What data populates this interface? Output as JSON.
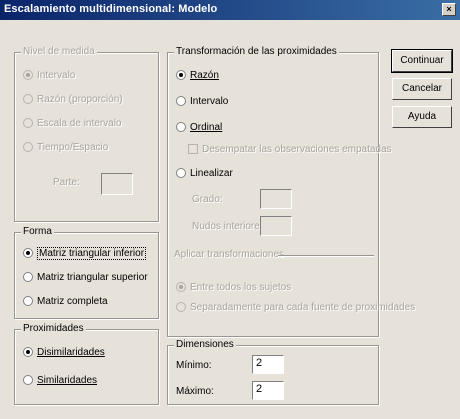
{
  "window": {
    "title": "Escalamiento multidimensional: Modelo",
    "close": "×"
  },
  "nivel_medida": {
    "legend": "Nivel de medida",
    "options": [
      "Intervalo",
      "Razón (proporción)",
      "Escala de intervalo",
      "Tiempo/Espacio"
    ],
    "selected": 0,
    "field_label": "Parte:",
    "field_value": ""
  },
  "transformacion": {
    "legend": "Transformación de las proximidades",
    "razon": "Razón",
    "intervalo": "Intervalo",
    "ordinal": "Ordinal",
    "ordinal_check": "Desempatar las observaciones empatadas",
    "spline": "Linealizar",
    "grado_label": "Grado:",
    "nudos_label": "Nudos interiores:",
    "selected": "razon"
  },
  "condicionalidad": {
    "legend": "Aplicar transformaciones",
    "options": [
      "Entre todos los sujetos",
      "Separadamente para cada fuente de proximidades"
    ]
  },
  "forma": {
    "legend": "Forma",
    "options": [
      "Matriz triangular inferior",
      "Matriz triangular superior",
      "Matriz completa"
    ],
    "selected": 0
  },
  "proximidades": {
    "legend": "Proximidades",
    "options": [
      "Disimilaridades",
      "Similaridades"
    ],
    "selected": 0
  },
  "dimensiones": {
    "legend": "Dimensiones",
    "min_label": "Mínimo:",
    "min_value": "2",
    "max_label": "Máximo:",
    "max_value": "2"
  },
  "buttons": {
    "continuar": "Continuar",
    "cancelar": "Cancelar",
    "ayuda": "Ayuda"
  }
}
